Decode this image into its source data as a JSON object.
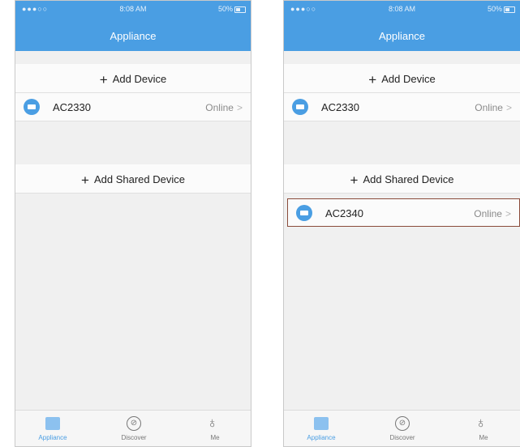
{
  "status_bar": {
    "signal": "●●●○○",
    "time": "8:08 AM",
    "battery": "50%"
  },
  "header": {
    "title": "Appliance"
  },
  "add_device_label": "Add Device",
  "add_shared_device_label": "Add Shared Device",
  "devices": [
    {
      "name": "AC2330",
      "status": "Online"
    }
  ],
  "shared_devices": [
    {
      "name": "AC2340",
      "status": "Online"
    }
  ],
  "tabs": [
    {
      "label": "Appliance",
      "icon": "appliance-icon"
    },
    {
      "label": "Discover",
      "icon": "compass-icon"
    },
    {
      "label": "Me",
      "icon": "person-icon"
    }
  ],
  "colors": {
    "accent": "#4a9ee3",
    "highlight": "#8a4b3a"
  }
}
